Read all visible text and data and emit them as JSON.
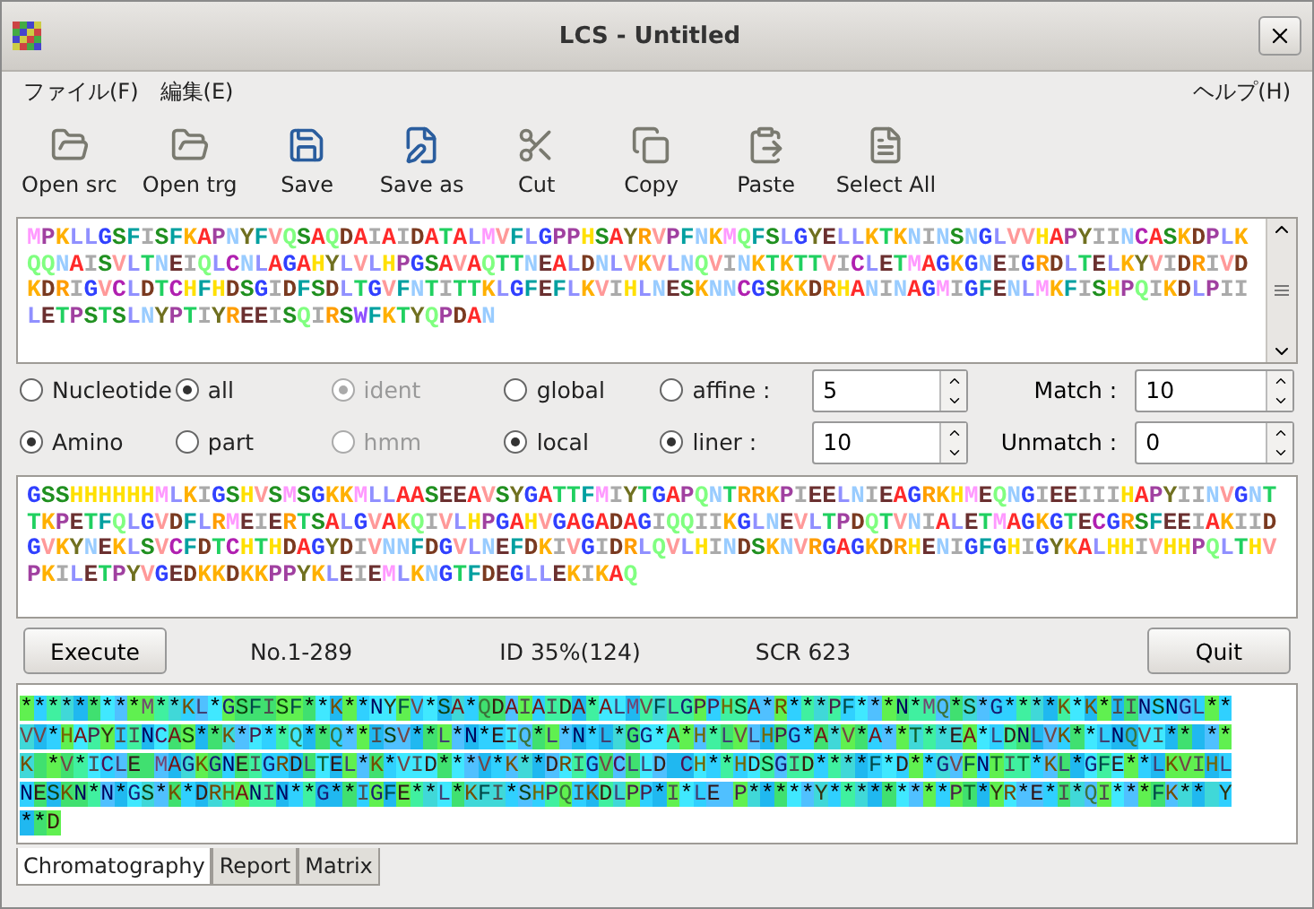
{
  "window": {
    "title": "LCS - Untitled"
  },
  "menu": {
    "left": [
      "ファイル(F)",
      "編集(E)"
    ],
    "right": [
      "ヘルプ(H)"
    ]
  },
  "toolbar": [
    "Open src",
    "Open trg",
    "Save",
    "Save as",
    "Cut",
    "Copy",
    "Paste",
    "Select All"
  ],
  "source": [
    "MPKLLGSFISFKAPNYFVQSAQDAIAIDATALMVFLGPPHSAYRVPFNKMQFSLGYELLKTKNINSNGLVVHAPYIINCASKDPLK",
    "QQNAISVLTNEIQLCNLAGAHYLVLHPGSAVAQTTNEALDNLVKVLNQVINKTKTTVICLETMAGKGNEIGRDLTELKYVIDRIVD",
    "KDRIGVCLDTCHFHDSGIDFSDLTGVFNTITTKLGFEFLKVIHLNESKNNCGSKKDRHANINAGMIGFENLMKFISHPQIKDLPII",
    "LETPSTSLNYPTIYREEISQIRSWFKTYQPDAN"
  ],
  "options": [
    [
      {
        "kind": "radio",
        "label": "Nucleotide",
        "selected": false,
        "disabled": false
      },
      {
        "kind": "radio",
        "label": "all",
        "selected": true,
        "disabled": false
      },
      {
        "kind": "radio",
        "label": "ident",
        "selected": true,
        "disabled": true
      },
      {
        "kind": "radio",
        "label": "global",
        "selected": false,
        "disabled": false
      },
      {
        "kind": "radio",
        "label": "affine :",
        "selected": false,
        "disabled": false
      },
      {
        "kind": "spin",
        "value": "5"
      },
      {
        "kind": "label",
        "label": "Match :"
      },
      {
        "kind": "spin",
        "value": "10"
      }
    ],
    [
      {
        "kind": "radio",
        "label": "Amino",
        "selected": true,
        "disabled": false
      },
      {
        "kind": "radio",
        "label": "part",
        "selected": false,
        "disabled": false
      },
      {
        "kind": "radio",
        "label": "hmm",
        "selected": false,
        "disabled": true
      },
      {
        "kind": "radio",
        "label": "local",
        "selected": true,
        "disabled": false
      },
      {
        "kind": "radio",
        "label": "liner :",
        "selected": true,
        "disabled": false
      },
      {
        "kind": "spin",
        "value": "10"
      },
      {
        "kind": "label",
        "label": "Unmatch :"
      },
      {
        "kind": "spin",
        "value": "0"
      }
    ]
  ],
  "target": [
    "GSSHHHHHHMLKIGSHVSMSGKKMLLAASEEAVSYGATTFMIYTGAPQNTRRKPIEELNIEAGRKHMEQNGIEEIIIHAPYIINVGNT",
    "TKPETFQLGVDFLRMEIERTSALGVAKQIVLHPGAHVGAGADAGIQQIIKGLNEVLTPDQTVNIALETMAGKGTECGRSFEEIAKIID",
    "GVKYNEKLSVCFDTCHTHDAGYDIVNNFDGVLNEFDKIVGIDRLQVLHINDSKNVRGAGKDRHENIGFGHIGYKALHHIVHHPQLTHV",
    "PKILETPYVGEDKKDKKPPYKLEIEMLKNGTFDEGLLEKIKAQ"
  ],
  "actions": {
    "execute": "Execute",
    "range": "No.1-289",
    "identity": "ID 35%(124)",
    "score": "SCR 623",
    "quit": "Quit"
  },
  "alignment": [
    "*********M**KL*GSFISF**K**NYFV*SA*QDAIAIDA*ALMVFLGPPHSA*R***PF***N*MQ*S*G****K*K*IINSNGL**",
    "VV*HAPYIINCAS**K*P**Q**Q**ISV**L*N*EIQ*L*N*L*GG*A*H*LVLHPG*A*V*A**T**EA*LDNLVK**LNQVI** **",
    "K *V*ICLE MAGKGNEIGRDLTEL*K*VID***V*K**DRIGVCLLD CH**HDSGID****F*D**GVFNTIT*KL*GFE**LKVIHL",
    "NESKN*N*GS*K*DRHANIN**G**IGFE**L*KFI*SHPQIKDLPP*I*LE P*****Y*********PT*YR*E*I*QI***FK** Y",
    "**D"
  ],
  "tabs": [
    {
      "label": "Chromatography",
      "selected": true
    },
    {
      "label": "Report",
      "selected": false
    },
    {
      "label": "Matrix",
      "selected": false
    }
  ]
}
